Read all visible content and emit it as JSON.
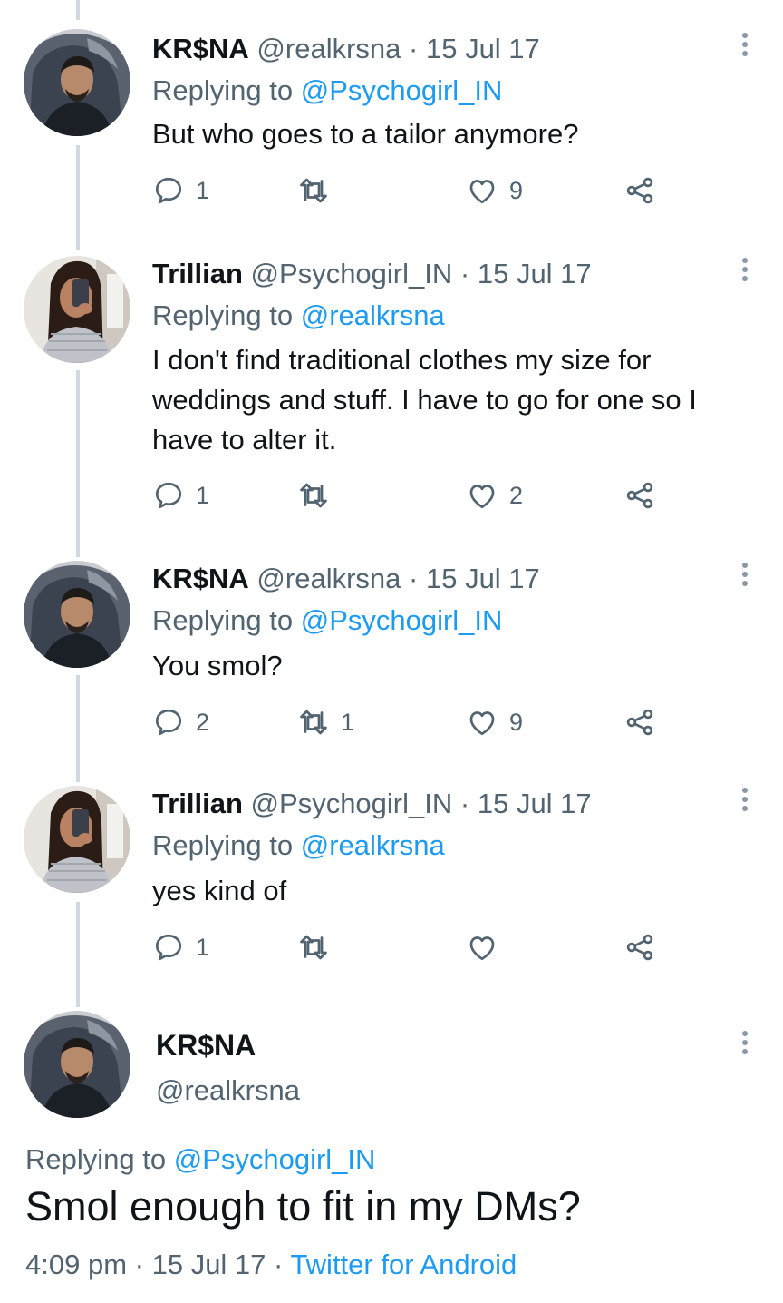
{
  "colors": {
    "accent": "#1d9bf0",
    "muted": "#536471",
    "text": "#0f1419",
    "thread_line": "#cfd9de"
  },
  "reply_prefix": "Replying to",
  "tweets": [
    {
      "name": "KR$NA",
      "handle": "@realkrsna",
      "dot": "·",
      "date": "15 Jul 17",
      "replying_to": "@Psychogirl_IN",
      "text": "But who goes to a tailor anymore?",
      "replies": "1",
      "retweets": "",
      "likes": "9",
      "avatar_icon": "avatar-krsna"
    },
    {
      "name": "Trillian",
      "handle": "@Psychogirl_IN",
      "dot": "·",
      "date": "15 Jul 17",
      "replying_to": "@realkrsna",
      "text": "I don't find traditional clothes my size for weddings and stuff. I have to go for one so I have to alter it.",
      "replies": "1",
      "retweets": "",
      "likes": "2",
      "avatar_icon": "avatar-trillian"
    },
    {
      "name": "KR$NA",
      "handle": "@realkrsna",
      "dot": "·",
      "date": "15 Jul 17",
      "replying_to": "@Psychogirl_IN",
      "text": "You smol?",
      "replies": "2",
      "retweets": "1",
      "likes": "9",
      "avatar_icon": "avatar-krsna"
    },
    {
      "name": "Trillian",
      "handle": "@Psychogirl_IN",
      "dot": "·",
      "date": "15 Jul 17",
      "replying_to": "@realkrsna",
      "text": "yes kind of",
      "replies": "1",
      "retweets": "",
      "likes": "",
      "avatar_icon": "avatar-trillian"
    }
  ],
  "main_tweet": {
    "name": "KR$NA",
    "handle": "@realkrsna",
    "replying_to": "@Psychogirl_IN",
    "text": "Smol enough to fit in my DMs?",
    "time": "4:09 pm",
    "dot1": "·",
    "date": "15 Jul 17",
    "dot2": "·",
    "source": "Twitter for Android"
  }
}
